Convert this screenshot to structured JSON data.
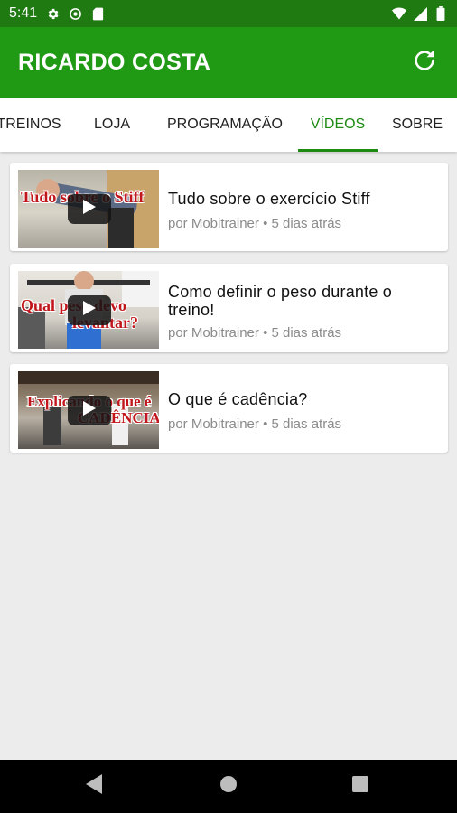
{
  "status_bar": {
    "time": "5:41"
  },
  "app_bar": {
    "title": "RICARDO COSTA"
  },
  "tabs": [
    {
      "label": "TREINOS"
    },
    {
      "label": "LOJA"
    },
    {
      "label": "PROGRAMAÇÃO"
    },
    {
      "label": "VÍDEOS",
      "active": true
    },
    {
      "label": "SOBRE"
    }
  ],
  "videos": [
    {
      "title": "Tudo sobre o exercício Stiff",
      "author": "por Mobitrainer",
      "separator": "•",
      "date": "5 dias atrás",
      "thumb_text": [
        "Tudo sobre o Stiff"
      ]
    },
    {
      "title": "Como definir o peso durante o treino!",
      "author": "por Mobitrainer",
      "separator": "•",
      "date": "5 dias atrás",
      "thumb_text": [
        "Qual peso devo",
        "levantar?"
      ]
    },
    {
      "title": "O que é cadência?",
      "author": "por Mobitrainer",
      "separator": "•",
      "date": "5 dias atrás",
      "thumb_text": [
        "Explicando o que é",
        "CADÊNCIA"
      ]
    }
  ],
  "colors": {
    "status_bar": "#1f7a12",
    "app_bar": "#209914",
    "accent": "#1d8a12",
    "background": "#ececec"
  },
  "icons": [
    "settings-icon",
    "sync-icon",
    "sd-card-icon",
    "wifi-icon",
    "signal-icon",
    "battery-icon",
    "refresh-icon",
    "play-icon",
    "back-icon",
    "home-icon",
    "recents-icon"
  ]
}
